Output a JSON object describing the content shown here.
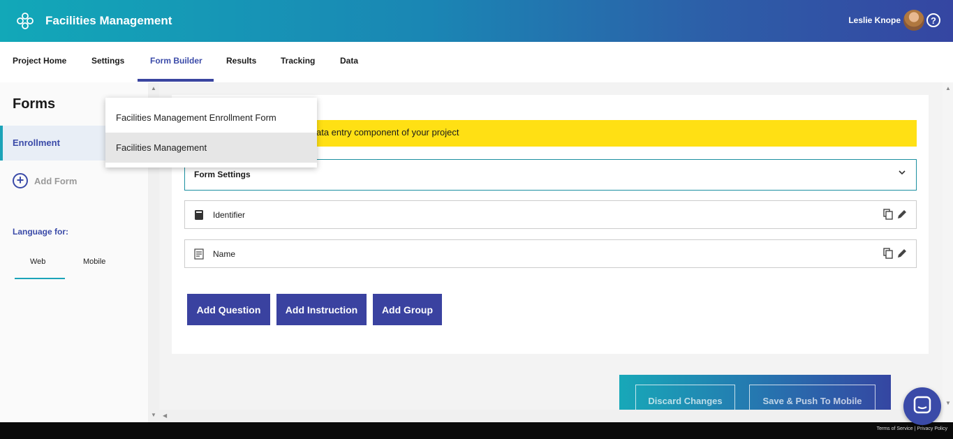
{
  "header": {
    "app_title": "Facilities Management",
    "user_name": "Leslie Knope",
    "help_symbol": "?"
  },
  "nav": {
    "items": [
      {
        "label": "Project Home"
      },
      {
        "label": "Settings"
      },
      {
        "label": "Form Builder",
        "active": true
      },
      {
        "label": "Results"
      },
      {
        "label": "Tracking"
      },
      {
        "label": "Data"
      }
    ]
  },
  "sidebar": {
    "title": "Forms",
    "selected_form": "Enrollment",
    "add_form_label": "Add Form",
    "language_label": "Language for:",
    "language_tabs": [
      "Web",
      "Mobile"
    ]
  },
  "dropdown": {
    "options": [
      "Facilities Management Enrollment Form",
      "Facilities Management"
    ],
    "selected": "Facilities Management"
  },
  "main": {
    "notice_text": "ata entry component of your project",
    "form_settings_label": "Form Settings",
    "questions": [
      {
        "label": "Identifier",
        "icon": "id-card-icon"
      },
      {
        "label": "Name",
        "icon": "text-field-icon"
      }
    ],
    "buttons": {
      "add_question": "Add Question",
      "add_instruction": "Add Instruction",
      "add_group": "Add Group"
    }
  },
  "bottom_bar": {
    "discard": "Discard Changes",
    "save_push": "Save & Push To Mobile"
  },
  "footer": {
    "terms": "Terms of Service",
    "privacy": "Privacy Policy",
    "separator": "|"
  },
  "colors": {
    "accent": "#3a42a0",
    "teal": "#1ba3b8",
    "notice": "#ffe014"
  }
}
